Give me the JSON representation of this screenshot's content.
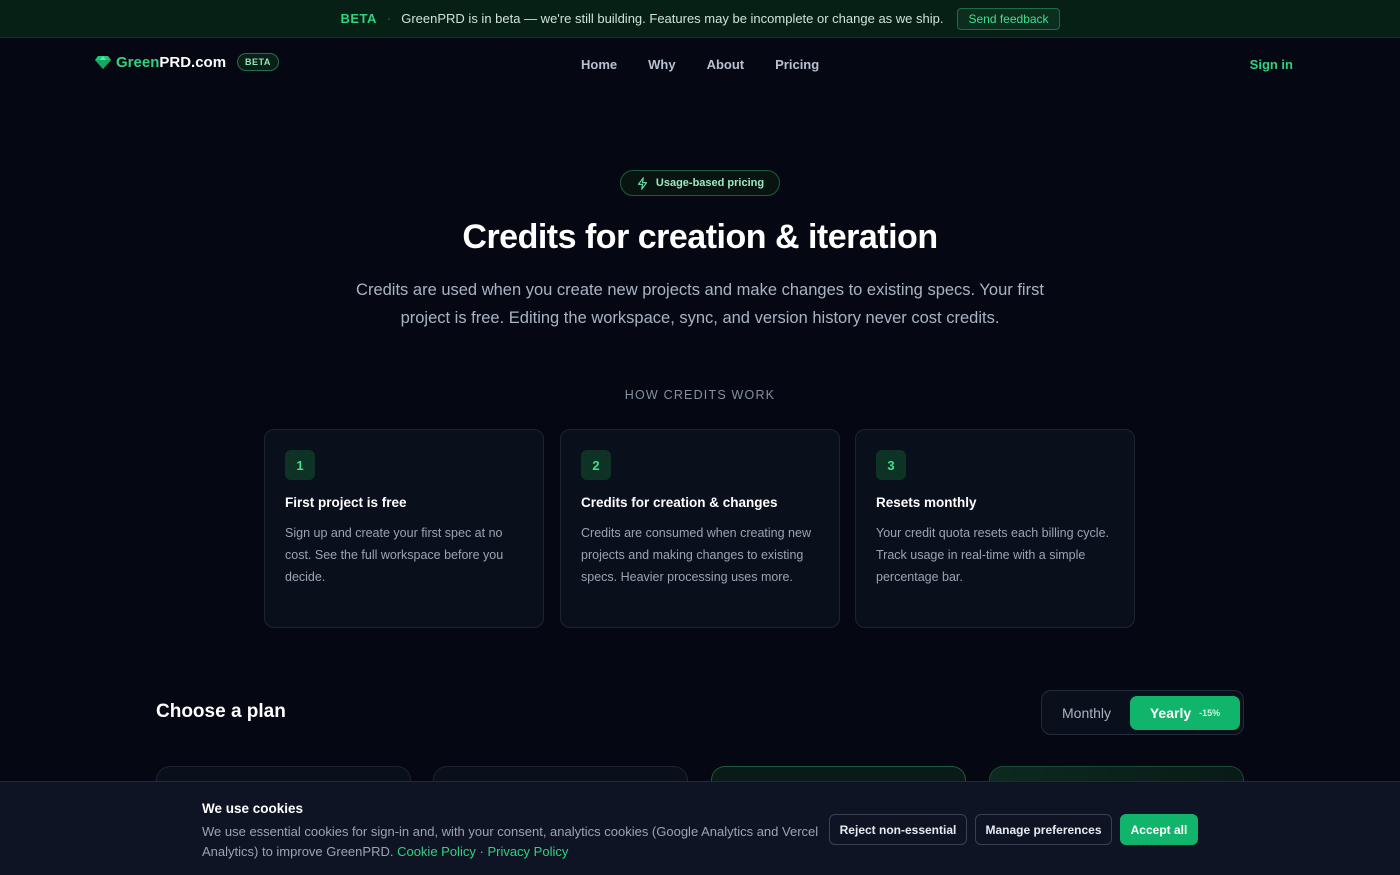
{
  "banner": {
    "tag": "BETA",
    "separator": "·",
    "message": "GreenPRD is in beta — we're still building. Features may be incomplete or change as we ship.",
    "feedback_label": "Send feedback"
  },
  "nav": {
    "logo_green": "Green",
    "logo_white": "PRD.com",
    "logo_badge": "BETA",
    "links": [
      "Home",
      "Why",
      "About",
      "Pricing"
    ],
    "sign_in": "Sign in"
  },
  "hero": {
    "pill": "Usage-based pricing",
    "title": "Credits for creation & iteration",
    "subtitle": "Credits are used when you create new projects and make changes to existing specs. Your first project is free. Editing the workspace, sync, and version history never cost credits."
  },
  "how": {
    "label": "HOW CREDITS WORK",
    "cards": [
      {
        "num": "1",
        "title": "First project is free",
        "desc": "Sign up and create your first spec at no cost. See the full workspace before you decide."
      },
      {
        "num": "2",
        "title": "Credits for creation & changes",
        "desc": "Credits are consumed when creating new projects and making changes to existing specs. Heavier processing uses more."
      },
      {
        "num": "3",
        "title": "Resets monthly",
        "desc": "Your credit quota resets each billing cycle. Track usage in real-time with a simple percentage bar."
      }
    ]
  },
  "plans": {
    "title": "Choose a plan",
    "toggle": {
      "monthly": "Monthly",
      "yearly": "Yearly",
      "discount": "-15%",
      "selected": "Yearly"
    }
  },
  "cookie": {
    "title": "We use cookies",
    "text": "We use essential cookies for sign-in and, with your consent, analytics cookies (Google Analytics and Vercel Analytics) to improve GreenPRD.",
    "cookie_policy": "Cookie Policy",
    "separator": "·",
    "privacy_policy": "Privacy Policy",
    "reject": "Reject non-essential",
    "manage": "Manage preferences",
    "accept": "Accept all"
  },
  "colors": {
    "accent": "#10b46a",
    "accent_text": "#2fd27f",
    "background": "#050813"
  }
}
